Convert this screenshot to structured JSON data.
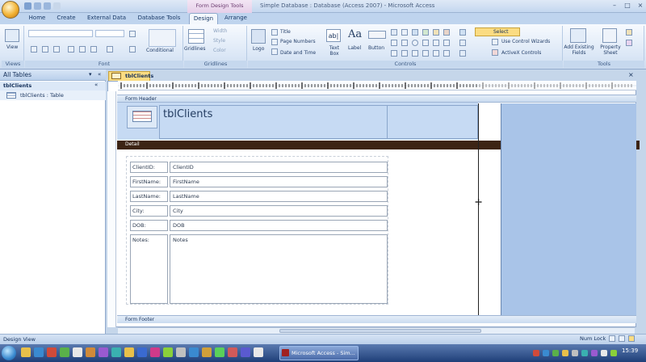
{
  "window": {
    "contextual_tools": "Form Design Tools",
    "app_title": "Simple Database : Database (Access 2007) - Microsoft Access",
    "tabs": [
      "Home",
      "Create",
      "External Data",
      "Database Tools",
      "Design",
      "Arrange"
    ],
    "active_tab": "Design"
  },
  "ribbon": {
    "groups": {
      "views": "Views",
      "font": "Font",
      "gridlines": "Gridlines",
      "controls": "Controls",
      "tools": "Tools"
    },
    "view_button": "View",
    "conditional": "Conditional",
    "gridlines_button": "Gridlines",
    "width_label": "Width",
    "style_label": "Style",
    "color_label": "Color",
    "logo": "Logo",
    "title": "Title",
    "page_numbers": "Page Numbers",
    "date_time": "Date and Time",
    "text_box": "Text Box",
    "label": "Label",
    "button": "Button",
    "use_control_wizards": "Use Control Wizards",
    "activex_controls": "ActiveX Controls",
    "select": "Select",
    "add_existing_fields": "Add Existing Fields",
    "property_sheet": "Property Sheet"
  },
  "nav": {
    "header": "All Tables",
    "group": "tblClients",
    "item": "tblClients : Table"
  },
  "document": {
    "tab": "tblClients",
    "form_header": "Form Header",
    "title": "tblClients",
    "detail": "Detail",
    "form_footer": "Form Footer",
    "fields": [
      {
        "label": "ClientID:",
        "control": "ClientID"
      },
      {
        "label": "FirstName:",
        "control": "FirstName"
      },
      {
        "label": "LastName:",
        "control": "LastName"
      },
      {
        "label": "City:",
        "control": "City"
      },
      {
        "label": "DOB:",
        "control": "DOB"
      },
      {
        "label": "Notes:",
        "control": "Notes"
      }
    ]
  },
  "status": {
    "left": "Design View",
    "num_lock": "Num Lock"
  },
  "taskbar": {
    "task": "Microsoft Access - Sim...",
    "clock": "15:39"
  }
}
